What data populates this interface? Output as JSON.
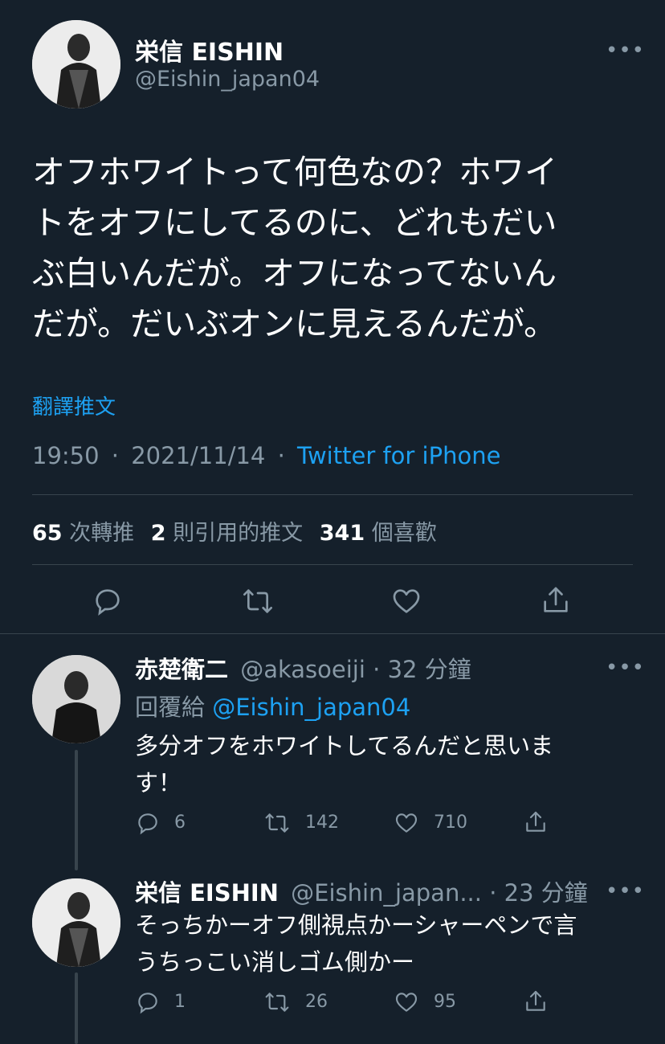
{
  "main_tweet": {
    "author_name": "栄信 EISHIN",
    "author_handle": "@Eishin_japan04",
    "text_lines": [
      "オフホワイトって何色なの？ホワイ",
      "トをオフにしてるのに、どれもだい",
      "ぶ白いんだが。オフになってないん",
      "だが。だいぶオンに見えるんだが。"
    ],
    "translate_label": "翻譯推文",
    "time": "19:50",
    "date": "2021/11/14",
    "separator": "·",
    "source": "Twitter for iPhone",
    "stats": {
      "retweets_num": "65",
      "retweets_label": "次轉推",
      "quotes_num": "2",
      "quotes_label": "則引用的推文",
      "likes_num": "341",
      "likes_label": "個喜歡"
    },
    "more_label": "•••"
  },
  "replies": [
    {
      "author_name": "赤楚衛二",
      "author_handle": "@akasoeiji",
      "time": "· 32 分鐘",
      "reply_to_label": "回覆給",
      "reply_to_handle": "@Eishin_japan04",
      "text_lines": [
        "多分オフをホワイトしてるんだと思いま",
        "す！"
      ],
      "reply_count": "6",
      "retweet_count": "142",
      "like_count": "710",
      "more_label": "•••"
    },
    {
      "author_name": "栄信 EISHIN",
      "author_handle": "@Eishin_japan...",
      "time": "· 23 分鐘",
      "text_lines": [
        "そっちかーオフ側視点かーシャーペンで言",
        "うちっこい消しゴム側かー"
      ],
      "reply_count": "1",
      "retweet_count": "26",
      "like_count": "95",
      "more_label": "•••"
    }
  ],
  "icons": {
    "reply": "reply-icon",
    "retweet": "retweet-icon",
    "like": "heart-icon",
    "share": "share-icon",
    "more": "more-icon"
  },
  "colors": {
    "background": "#15202b",
    "link": "#1da1f2",
    "muted": "#8899a6",
    "divider": "#38444d"
  }
}
